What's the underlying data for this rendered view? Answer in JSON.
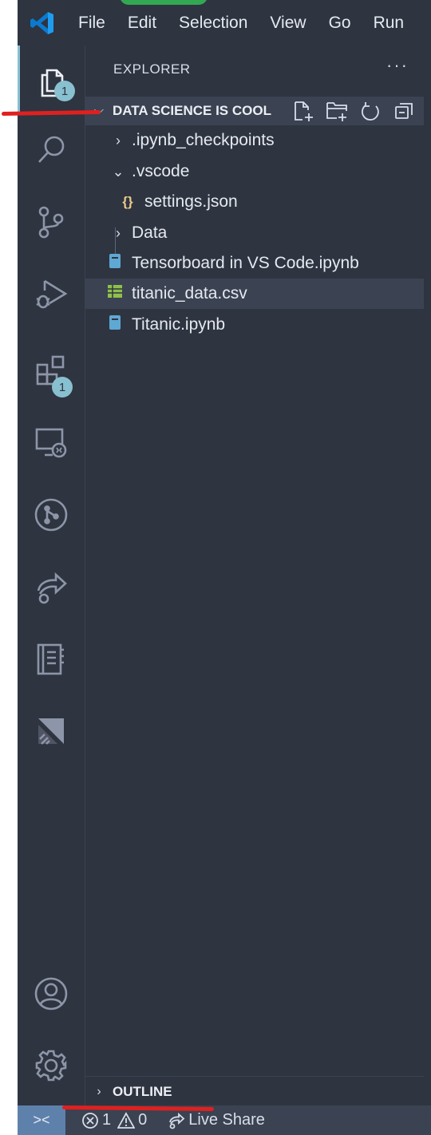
{
  "menu": [
    "File",
    "Edit",
    "Selection",
    "View",
    "Go",
    "Run"
  ],
  "activity": {
    "explorer_badge": "1",
    "extensions_badge": "1"
  },
  "sidebar": {
    "title": "EXPLORER",
    "more": "···",
    "section_title": "DATA SCIENCE IS COOL",
    "tree": [
      {
        "label": ".ipynb_checkpoints",
        "kind": "folder",
        "expanded": false,
        "depth": 0
      },
      {
        "label": ".vscode",
        "kind": "folder",
        "expanded": true,
        "depth": 0
      },
      {
        "label": "settings.json",
        "kind": "json",
        "depth": 1
      },
      {
        "label": "Data",
        "kind": "folder",
        "expanded": false,
        "depth": 0
      },
      {
        "label": "Tensorboard in VS Code.ipynb",
        "kind": "notebook",
        "depth": 0
      },
      {
        "label": "titanic_data.csv",
        "kind": "csv",
        "depth": 0,
        "selected": true
      },
      {
        "label": "Titanic.ipynb",
        "kind": "notebook",
        "depth": 0
      }
    ],
    "outline_title": "OUTLINE"
  },
  "status": {
    "errors": "1",
    "warnings": "0",
    "live_share": "Live Share"
  },
  "colors": {
    "background": "#2e3440",
    "accent": "#88c0d0",
    "selection": "#3b4252",
    "annotation": "#e0201f"
  }
}
